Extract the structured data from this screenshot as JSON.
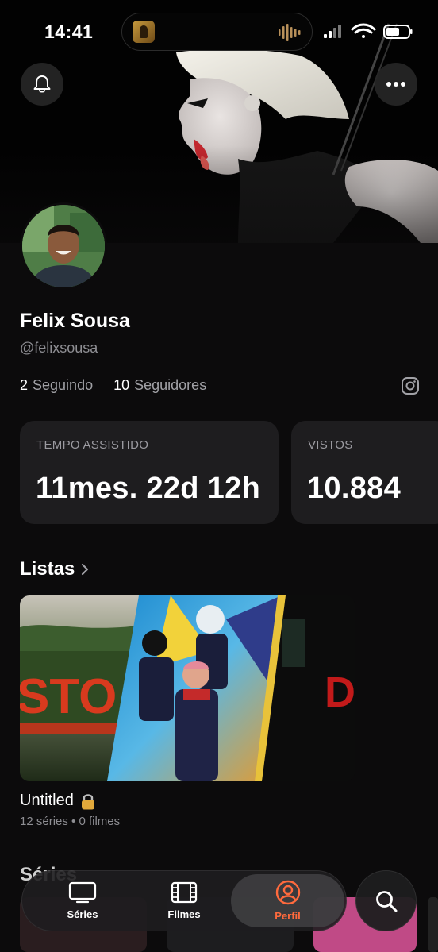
{
  "status_bar": {
    "time": "14:41",
    "now_playing_art": "album-art-icon",
    "icons": [
      "audio-wave-icon",
      "signal-icon",
      "wifi-icon",
      "battery-icon"
    ]
  },
  "header": {
    "banner": "singer-performance-photo",
    "buttons": [
      "bell-icon",
      "more-icon"
    ]
  },
  "profile": {
    "name": "Felix Sousa",
    "handle": "@felixsousa",
    "following_count": "2",
    "following_label": "Seguindo",
    "followers_count": "10",
    "followers_label": "Seguidores",
    "social_icon": "instagram-icon"
  },
  "stats": {
    "watch_time_label": "TEMPO ASSISTIDO",
    "watch_time_value": "11mes. 22d 12h",
    "watched_label": "VISTOS",
    "watched_value": "10.884"
  },
  "lists": {
    "title": "Listas",
    "items": [
      {
        "name": "Untitled",
        "meta": "12 séries • 0 filmes",
        "locked": true
      }
    ]
  },
  "series_section": {
    "title": "Séries"
  },
  "tabbar": {
    "tabs": [
      {
        "label": "Séries",
        "icon": "tv-icon",
        "active": false
      },
      {
        "label": "Filmes",
        "icon": "film-icon",
        "active": false
      },
      {
        "label": "Perfil",
        "icon": "profile-icon",
        "active": true
      }
    ],
    "search_icon": "search-icon"
  },
  "colors": {
    "background": "#0c0b0c",
    "card": "#1e1d1f",
    "accent": "#ff6a3d",
    "muted_text": "#8e8e93"
  }
}
